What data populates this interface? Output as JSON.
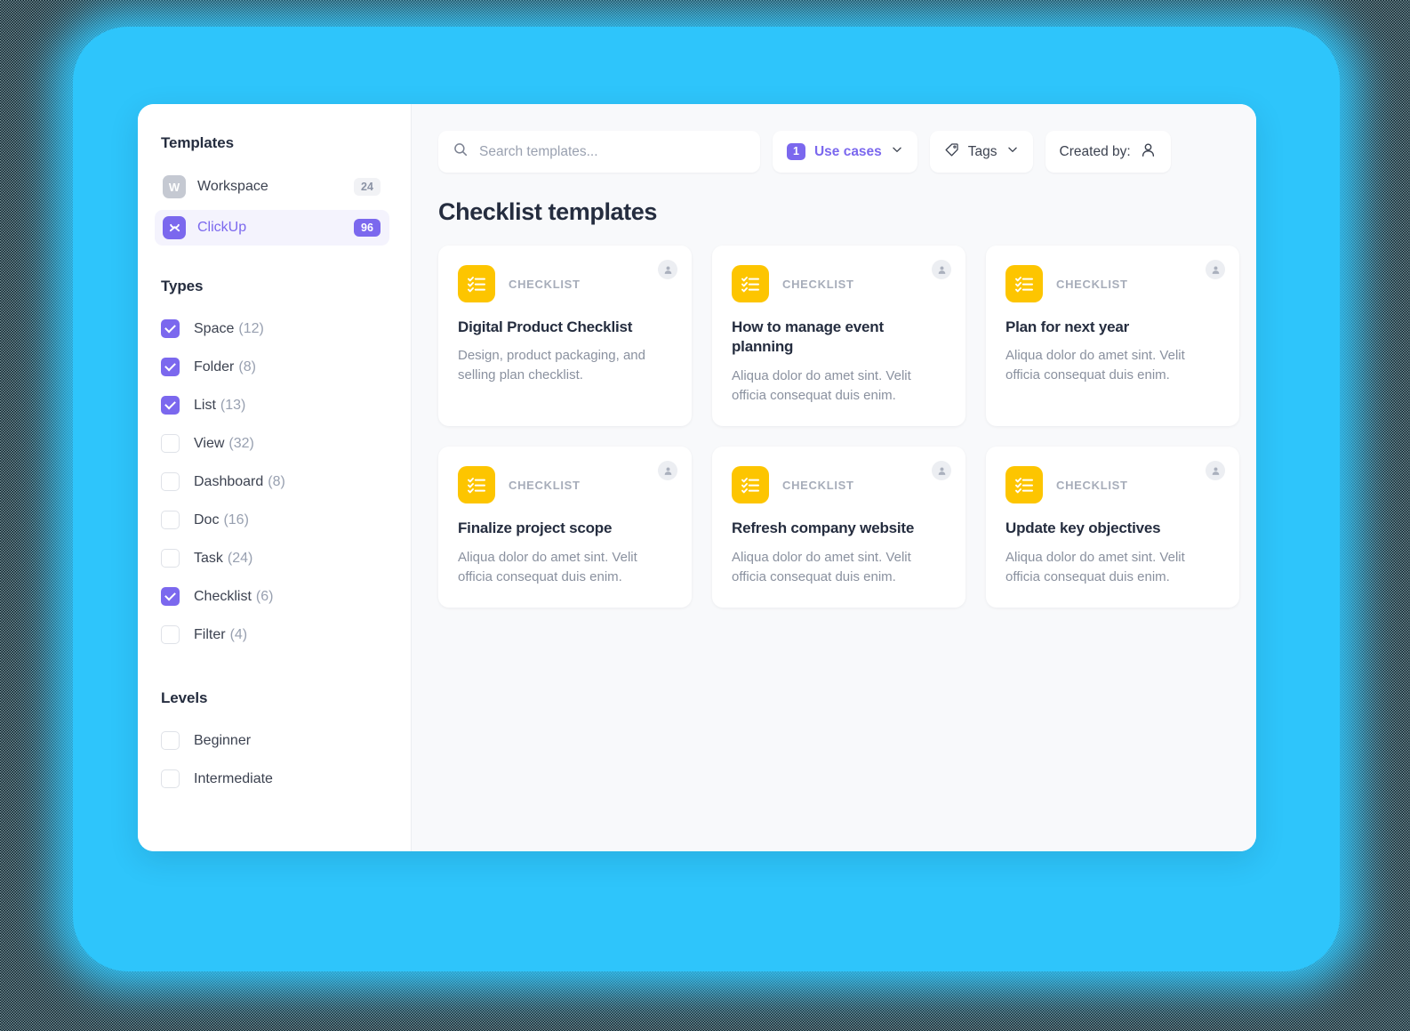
{
  "sidebar": {
    "templates_heading": "Templates",
    "workspaces": [
      {
        "icon": "workspace-avatar-icon",
        "initial": "W",
        "label": "Workspace",
        "count": "24",
        "active": false
      },
      {
        "icon": "clickup-logo-icon",
        "initial": "",
        "label": "ClickUp",
        "count": "96",
        "active": true
      }
    ],
    "types_heading": "Types",
    "types": [
      {
        "label": "Space",
        "count": "(12)",
        "checked": true
      },
      {
        "label": "Folder",
        "count": "(8)",
        "checked": true
      },
      {
        "label": "List",
        "count": "(13)",
        "checked": true
      },
      {
        "label": "View",
        "count": "(32)",
        "checked": false
      },
      {
        "label": "Dashboard",
        "count": "(8)",
        "checked": false
      },
      {
        "label": "Doc",
        "count": "(16)",
        "checked": false
      },
      {
        "label": "Task",
        "count": "(24)",
        "checked": false
      },
      {
        "label": "Checklist",
        "count": "(6)",
        "checked": true
      },
      {
        "label": "Filter",
        "count": "(4)",
        "checked": false
      }
    ],
    "levels_heading": "Levels",
    "levels": [
      {
        "label": "Beginner",
        "checked": false
      },
      {
        "label": "Intermediate",
        "checked": false
      }
    ]
  },
  "toolbar": {
    "search_placeholder": "Search templates...",
    "search_value": "",
    "use_cases": {
      "badge": "1",
      "label": "Use cases"
    },
    "tags": {
      "label": "Tags"
    },
    "created_by": {
      "label": "Created by:"
    }
  },
  "main": {
    "title": "Checklist templates",
    "cards": [
      {
        "kind": "CHECKLIST",
        "title": "Digital Product Checklist",
        "desc": "Design, product packaging, and selling plan checklist."
      },
      {
        "kind": "CHECKLIST",
        "title": "How to manage event planning",
        "desc": "Aliqua dolor do amet sint. Velit officia consequat duis enim."
      },
      {
        "kind": "CHECKLIST",
        "title": "Plan for next year",
        "desc": "Aliqua dolor do amet sint. Velit officia consequat duis enim."
      },
      {
        "kind": "CHECKLIST",
        "title": "Finalize project scope",
        "desc": "Aliqua dolor do amet sint. Velit officia consequat duis enim."
      },
      {
        "kind": "CHECKLIST",
        "title": "Refresh company website",
        "desc": "Aliqua dolor do amet sint. Velit officia consequat duis enim."
      },
      {
        "kind": "CHECKLIST",
        "title": "Update key objectives",
        "desc": "Aliqua dolor do amet sint. Velit officia consequat duis enim."
      }
    ]
  },
  "colors": {
    "accent": "#7b68ee",
    "checklist_yellow": "#fdc500",
    "backdrop": "#2ec5fb",
    "content_bg": "#f8f9fb"
  }
}
